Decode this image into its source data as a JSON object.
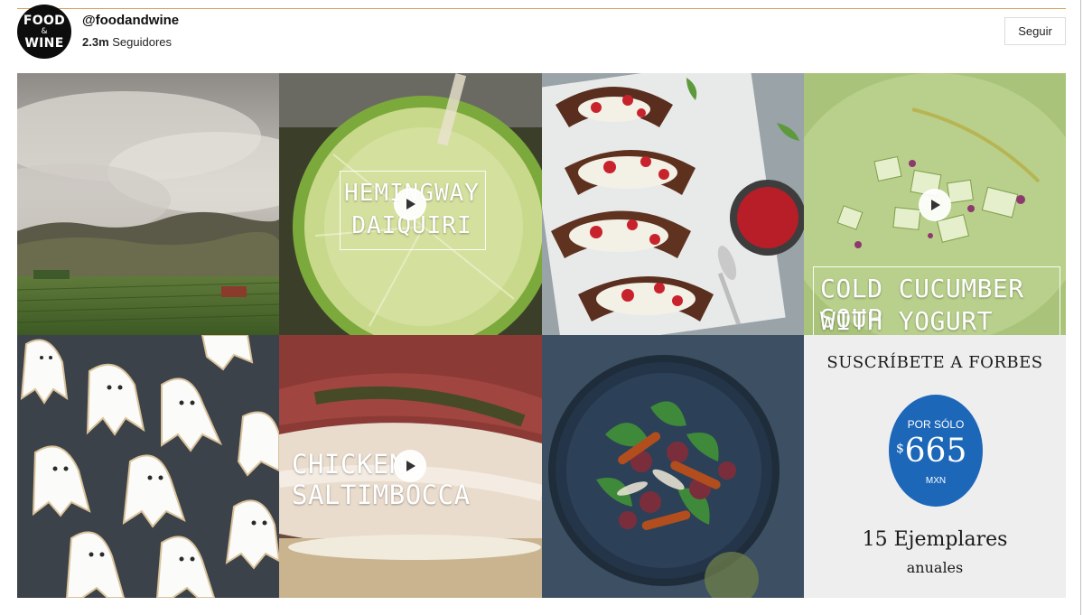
{
  "profile": {
    "avatar_line1": "FOOD",
    "avatar_amp": "&",
    "avatar_line2": "WINE",
    "handle": "@foodandwine",
    "followers_count": "2.3m",
    "followers_label": "Seguidores",
    "follow_button": "Seguir"
  },
  "grid": {
    "tiles": [
      {
        "id": "wildfire-landscape",
        "is_video": false
      },
      {
        "id": "hemingway-daiquiri",
        "is_video": true,
        "caption_line1": "HEMINGWAY",
        "caption_line2": "DAIQUIRI"
      },
      {
        "id": "strawberry-waffle-tacos",
        "is_video": false
      },
      {
        "id": "cold-cucumber-soup",
        "is_video": true,
        "caption_line1": "COLD CUCUMBER SOUP",
        "caption_line2": "WITH YOGURT AND DILL"
      },
      {
        "id": "ghost-cookies",
        "is_video": false
      },
      {
        "id": "chicken-saltimbocca",
        "is_video": true,
        "caption_line1": "CHICKEN SALTIMBOCCA"
      },
      {
        "id": "fig-salad",
        "is_video": false
      },
      {
        "id": "forbes-ad",
        "is_video": false
      }
    ]
  },
  "ad": {
    "title": "SUSCRÍBETE A FORBES",
    "price_label": "POR SÓLO",
    "currency_symbol": "$",
    "price": "665",
    "currency": "MXN",
    "copy": "15 Ejemplares",
    "sub": "anuales",
    "brand_color": "#1d67b9"
  },
  "colors": {
    "accent_rule": "#d9a15a",
    "text": "#111111"
  },
  "icons": {
    "play": "play-icon"
  }
}
